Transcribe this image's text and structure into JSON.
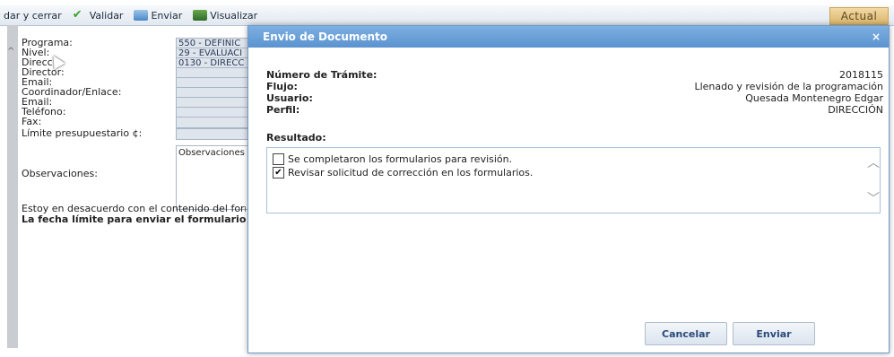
{
  "toolbar": {
    "items": [
      {
        "label": "dar y cerrar",
        "icon": "save-close-icon"
      },
      {
        "label": "Validar",
        "icon": "check-icon"
      },
      {
        "label": "Enviar",
        "icon": "send-icon"
      },
      {
        "label": "Visualizar",
        "icon": "view-icon"
      }
    ],
    "actual_label": "Actual"
  },
  "background_form": {
    "fields": [
      {
        "label": "Programa:",
        "value": "550 - DEFINIC"
      },
      {
        "label": "Nivel:",
        "value": "29 - EVALUACI"
      },
      {
        "label": "Direcc",
        "value": "0130 - DIRECC"
      },
      {
        "label": "Director:",
        "value": ""
      },
      {
        "label": "Email:",
        "value": ""
      },
      {
        "label": "Coordinador/Enlace:",
        "value": ""
      },
      {
        "label": "Email:",
        "value": ""
      },
      {
        "label": "Teléfono:",
        "value": ""
      },
      {
        "label": "Fax:",
        "value": ""
      },
      {
        "label": "Límite presupuestario ¢:",
        "value": ""
      }
    ],
    "observaciones_label": "Observaciones:",
    "observaciones_value": "Observaciones",
    "note_1": "Estoy en desacuerdo con el contenido del form",
    "note_2": "La fecha límite para enviar el formulario"
  },
  "dialog": {
    "title": "Envio de Documento",
    "close_symbol": "×",
    "info": [
      {
        "key": "Número de Trámite:",
        "value": "2018115"
      },
      {
        "key": "Flujo:",
        "value": "Llenado y revisión de la programación"
      },
      {
        "key": "Usuario:",
        "value": "Quesada Montenegro Edgar"
      },
      {
        "key": "Perfil:",
        "value": "DIRECCIÓN"
      }
    ],
    "resultado_label": "Resultado:",
    "options": [
      {
        "label": "Se completaron los formularios para revisión.",
        "checked": false
      },
      {
        "label": "Revisar solicitud de corrección en los formularios.",
        "checked": true
      }
    ],
    "cancel_label": "Cancelar",
    "send_label": "Enviar"
  },
  "colors": {
    "title_bar": "#5b93cf",
    "actual_tab": "#d9b56a"
  }
}
